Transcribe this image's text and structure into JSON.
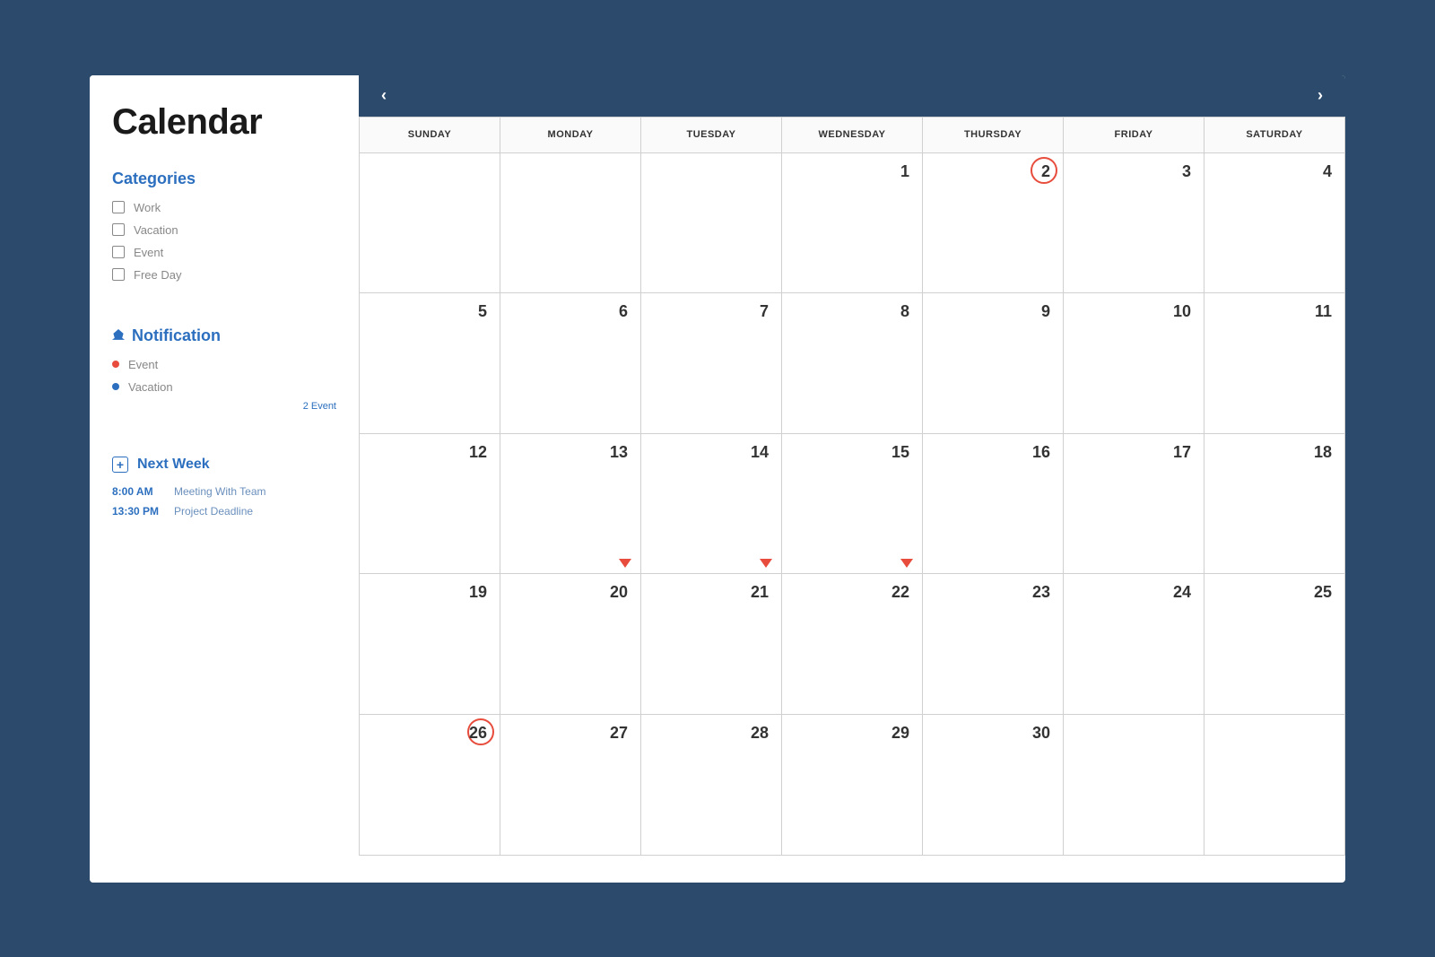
{
  "app_title": "Calendar",
  "sidebar": {
    "categories_title": "Categories",
    "categories": [
      {
        "label": "Work"
      },
      {
        "label": "Vacation"
      },
      {
        "label": "Event"
      },
      {
        "label": "Free Day"
      }
    ],
    "notification_title": "Notification",
    "notifications": [
      {
        "label": "Event",
        "color": "red"
      },
      {
        "label": "Vacation",
        "color": "blue"
      }
    ],
    "notification_count": "2 Event",
    "nextweek_title": "Next Week",
    "nextweek": [
      {
        "time": "8:00 AM",
        "label": "Meeting With Team"
      },
      {
        "time": "13:30 PM",
        "label": "Project Deadline"
      }
    ]
  },
  "calendar": {
    "day_headers": [
      "SUNDAY",
      "MONDAY",
      "TUESDAY",
      "WEDNESDAY",
      "THURSDAY",
      "FRIDAY",
      "SATURDAY"
    ],
    "weeks": [
      [
        {
          "n": ""
        },
        {
          "n": ""
        },
        {
          "n": ""
        },
        {
          "n": "1"
        },
        {
          "n": "2",
          "circled": true
        },
        {
          "n": "3"
        },
        {
          "n": "4"
        }
      ],
      [
        {
          "n": "5"
        },
        {
          "n": "6"
        },
        {
          "n": "7"
        },
        {
          "n": "8"
        },
        {
          "n": "9"
        },
        {
          "n": "10"
        },
        {
          "n": "11"
        }
      ],
      [
        {
          "n": "12"
        },
        {
          "n": "13",
          "flag": true
        },
        {
          "n": "14",
          "flag": true
        },
        {
          "n": "15",
          "flag": true
        },
        {
          "n": "16"
        },
        {
          "n": "17"
        },
        {
          "n": "18"
        }
      ],
      [
        {
          "n": "19"
        },
        {
          "n": "20"
        },
        {
          "n": "21"
        },
        {
          "n": "22"
        },
        {
          "n": "23"
        },
        {
          "n": "24"
        },
        {
          "n": "25"
        }
      ],
      [
        {
          "n": "26",
          "circled": true
        },
        {
          "n": "27"
        },
        {
          "n": "28"
        },
        {
          "n": "29"
        },
        {
          "n": "30"
        },
        {
          "n": ""
        },
        {
          "n": ""
        }
      ]
    ]
  }
}
